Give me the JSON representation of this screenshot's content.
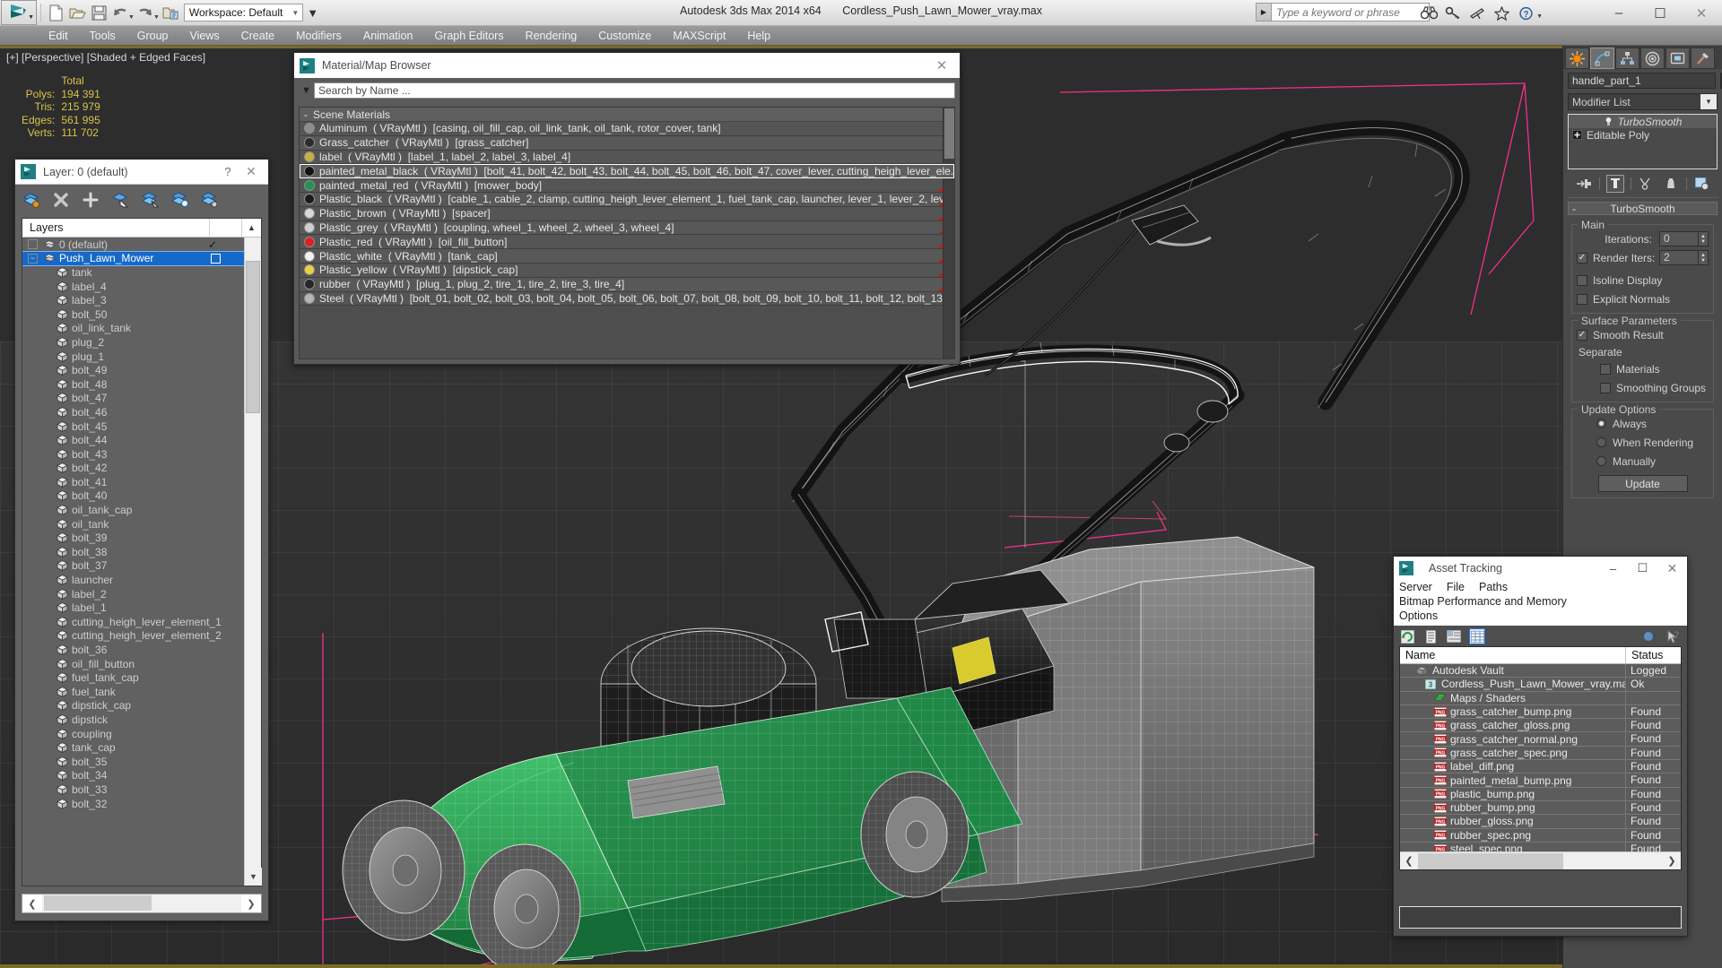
{
  "titlebar": {
    "app_title": "Autodesk 3ds Max  2014 x64",
    "file_title": "Cordless_Push_Lawn_Mower_vray.max",
    "workspace_label": "Workspace: Default",
    "search_placeholder": "Type a keyword or phrase",
    "qat_buttons": [
      "new-icon",
      "open-icon",
      "save-icon",
      "undo-icon",
      "redo-icon",
      "set-project-folder-icon"
    ],
    "right_icons": [
      "binoculars-icon",
      "key-icon",
      "satellite-icon",
      "star-icon",
      "help-icon"
    ],
    "window_buttons": [
      "minimize",
      "maximize",
      "close"
    ]
  },
  "menubar": {
    "items": [
      "Edit",
      "Tools",
      "Group",
      "Views",
      "Create",
      "Modifiers",
      "Animation",
      "Graph Editors",
      "Rendering",
      "Customize",
      "MAXScript",
      "Help"
    ]
  },
  "viewport": {
    "label": "[+] [Perspective] [Shaded + Edged Faces]",
    "stats_header": "Total",
    "stats": [
      {
        "key": "Polys:",
        "value": "194 391"
      },
      {
        "key": "Tris:",
        "value": "215 979"
      },
      {
        "key": "Edges:",
        "value": "561 995"
      },
      {
        "key": "Verts:",
        "value": "111 702"
      }
    ]
  },
  "layer_dialog": {
    "title": "Layer: 0 (default)",
    "help_glyph": "?",
    "close_glyph": "✕",
    "toolbar_icons": [
      "create-new-layer-icon",
      "delete-layer-icon",
      "add-selection-icon",
      "select-objects-icon",
      "select-highlighted-icon",
      "highlight-selected-icon",
      "layer-properties-icon"
    ],
    "column_header": "Layers",
    "rows": [
      {
        "label": "0 (default)",
        "level": 0,
        "type": "layer",
        "selected": false,
        "check": true
      },
      {
        "label": "Push_Lawn_Mower",
        "level": 0,
        "type": "layer",
        "selected": true,
        "check": false
      },
      {
        "label": "tank",
        "level": 1,
        "type": "object"
      },
      {
        "label": "label_4",
        "level": 1,
        "type": "object"
      },
      {
        "label": "label_3",
        "level": 1,
        "type": "object"
      },
      {
        "label": "bolt_50",
        "level": 1,
        "type": "object"
      },
      {
        "label": "oil_link_tank",
        "level": 1,
        "type": "object"
      },
      {
        "label": "plug_2",
        "level": 1,
        "type": "object"
      },
      {
        "label": "plug_1",
        "level": 1,
        "type": "object"
      },
      {
        "label": "bolt_49",
        "level": 1,
        "type": "object"
      },
      {
        "label": "bolt_48",
        "level": 1,
        "type": "object"
      },
      {
        "label": "bolt_47",
        "level": 1,
        "type": "object"
      },
      {
        "label": "bolt_46",
        "level": 1,
        "type": "object"
      },
      {
        "label": "bolt_45",
        "level": 1,
        "type": "object"
      },
      {
        "label": "bolt_44",
        "level": 1,
        "type": "object"
      },
      {
        "label": "bolt_43",
        "level": 1,
        "type": "object"
      },
      {
        "label": "bolt_42",
        "level": 1,
        "type": "object"
      },
      {
        "label": "bolt_41",
        "level": 1,
        "type": "object"
      },
      {
        "label": "bolt_40",
        "level": 1,
        "type": "object"
      },
      {
        "label": "oil_tank_cap",
        "level": 1,
        "type": "object"
      },
      {
        "label": "oil_tank",
        "level": 1,
        "type": "object"
      },
      {
        "label": "bolt_39",
        "level": 1,
        "type": "object"
      },
      {
        "label": "bolt_38",
        "level": 1,
        "type": "object"
      },
      {
        "label": "bolt_37",
        "level": 1,
        "type": "object"
      },
      {
        "label": "launcher",
        "level": 1,
        "type": "object"
      },
      {
        "label": "label_2",
        "level": 1,
        "type": "object"
      },
      {
        "label": "label_1",
        "level": 1,
        "type": "object"
      },
      {
        "label": "cutting_heigh_lever_element_1",
        "level": 1,
        "type": "object"
      },
      {
        "label": "cutting_heigh_lever_element_2",
        "level": 1,
        "type": "object"
      },
      {
        "label": "bolt_36",
        "level": 1,
        "type": "object"
      },
      {
        "label": "oil_fill_button",
        "level": 1,
        "type": "object"
      },
      {
        "label": "fuel_tank_cap",
        "level": 1,
        "type": "object"
      },
      {
        "label": "fuel_tank",
        "level": 1,
        "type": "object"
      },
      {
        "label": "dipstick_cap",
        "level": 1,
        "type": "object"
      },
      {
        "label": "dipstick",
        "level": 1,
        "type": "object"
      },
      {
        "label": "coupling",
        "level": 1,
        "type": "object"
      },
      {
        "label": "tank_cap",
        "level": 1,
        "type": "object"
      },
      {
        "label": "bolt_35",
        "level": 1,
        "type": "object"
      },
      {
        "label": "bolt_34",
        "level": 1,
        "type": "object"
      },
      {
        "label": "bolt_33",
        "level": 1,
        "type": "object"
      },
      {
        "label": "bolt_32",
        "level": 1,
        "type": "object"
      }
    ]
  },
  "material_browser": {
    "title": "Material/Map Browser",
    "close_glyph": "✕",
    "search_value": "Search by Name ...",
    "group_label": "Scene Materials",
    "group_toggle": "-",
    "materials": [
      {
        "name": "Aluminum",
        "type": "( VRayMtl )",
        "objects": "[casing, oil_fill_cap, oil_link_tank, oil_tank, rotor_cover, tank]",
        "swatch": "#8d8d8d",
        "selected": false,
        "flag": false
      },
      {
        "name": "Grass_catcher",
        "type": "( VRayMtl )",
        "objects": "[grass_catcher]",
        "swatch": "#2b2b2b",
        "selected": false,
        "flag": false
      },
      {
        "name": "label",
        "type": "( VRayMtl )",
        "objects": "[label_1, label_2, label_3, label_4]",
        "swatch": "#c8b040",
        "selected": false,
        "flag": false
      },
      {
        "name": "painted_metal_black",
        "type": "( VRayMtl )",
        "objects": "[bolt_41, bolt_42, bolt_43, bolt_44, bolt_45, bolt_46, bolt_47, cover_lever, cutting_heigh_lever_ele...",
        "swatch": "#141414",
        "selected": true,
        "flag": false
      },
      {
        "name": "painted_metal_red",
        "type": "( VRayMtl )",
        "objects": "[mower_body]",
        "swatch": "#1f9450",
        "selected": false,
        "flag": true
      },
      {
        "name": "Plastic_black",
        "type": "( VRayMtl )",
        "objects": "[cable_1, cable_2, clamp, cutting_heigh_lever_element_1, fuel_tank_cap, launcher, lever_1, lever_2, lever_...",
        "swatch": "#1a1a1a",
        "selected": false,
        "flag": true
      },
      {
        "name": "Plastic_brown",
        "type": "( VRayMtl )",
        "objects": "[spacer]",
        "swatch": "#d9d9d4",
        "selected": false,
        "flag": true
      },
      {
        "name": "Plastic_grey",
        "type": "( VRayMtl )",
        "objects": "[coupling, wheel_1, wheel_2, wheel_3, wheel_4]",
        "swatch": "#cfcfcf",
        "selected": false,
        "flag": true
      },
      {
        "name": "Plastic_red",
        "type": "( VRayMtl )",
        "objects": "[oil_fill_button]",
        "swatch": "#e02020",
        "selected": false,
        "flag": true
      },
      {
        "name": "Plastic_white",
        "type": "( VRayMtl )",
        "objects": "[tank_cap]",
        "swatch": "#f2f2f2",
        "selected": false,
        "flag": true
      },
      {
        "name": "Plastic_yellow",
        "type": "( VRayMtl )",
        "objects": "[dipstick_cap]",
        "swatch": "#e8d23c",
        "selected": false,
        "flag": true
      },
      {
        "name": "rubber",
        "type": "( VRayMtl )",
        "objects": "[plug_1, plug_2, tire_1, tire_2, tire_3, tire_4]",
        "swatch": "#262626",
        "selected": false,
        "flag": true
      },
      {
        "name": "Steel",
        "type": "( VRayMtl )",
        "objects": "[bolt_01, bolt_02, bolt_03, bolt_04, bolt_05, bolt_06, bolt_07, bolt_08, bolt_09, bolt_10, bolt_11, bolt_12, bolt_13,...",
        "swatch": "#b5b5b5",
        "selected": false,
        "flag": false
      }
    ]
  },
  "command_panel": {
    "tabs": [
      "create-tab-icon",
      "modify-tab-icon",
      "hierarchy-tab-icon",
      "motion-tab-icon",
      "display-tab-icon",
      "utilities-tab-icon"
    ],
    "active_tab_index": 1,
    "object_name": "handle_part_1",
    "modifier_list_label": "Modifier List",
    "stack": [
      {
        "label": "TurboSmooth",
        "active": true
      },
      {
        "label": "Editable Poly",
        "active": false
      }
    ],
    "rollout": {
      "title": "TurboSmooth",
      "collapse_glyph": "-",
      "groups": [
        {
          "title": "Main",
          "fields": [
            {
              "kind": "spinner",
              "label": "Iterations:",
              "value": "0",
              "checkbox": null
            },
            {
              "kind": "spinner",
              "label": "Render Iters:",
              "value": "2",
              "checkbox": true
            },
            {
              "kind": "checkbox",
              "label": "Isoline Display",
              "checked": false
            },
            {
              "kind": "checkbox",
              "label": "Explicit Normals",
              "checked": false
            }
          ]
        },
        {
          "title": "Surface Parameters",
          "fields": [
            {
              "kind": "checkbox",
              "label": "Smooth Result",
              "checked": true
            },
            {
              "kind": "text",
              "label": "Separate"
            },
            {
              "kind": "checkbox-indent",
              "label": "Materials",
              "checked": false
            },
            {
              "kind": "checkbox-indent",
              "label": "Smoothing Groups",
              "checked": false
            }
          ]
        },
        {
          "title": "Update Options",
          "fields": [
            {
              "kind": "radio",
              "label": "Always",
              "checked": true
            },
            {
              "kind": "radio",
              "label": "When Rendering",
              "checked": false
            },
            {
              "kind": "radio",
              "label": "Manually",
              "checked": false
            },
            {
              "kind": "button",
              "label": "Update"
            }
          ]
        }
      ]
    }
  },
  "asset_tracking": {
    "title": "Asset Tracking",
    "window_buttons": [
      "–",
      "☐",
      "✕"
    ],
    "menu": [
      "Server",
      "File",
      "Paths",
      "Bitmap Performance and Memory",
      "Options"
    ],
    "toolbar_icons": [
      "refresh-icon",
      "list-view-icon",
      "detail-view-icon",
      "grid-view-icon",
      "add-help-icon",
      "help-cursor-icon"
    ],
    "columns": [
      "Name",
      "Status"
    ],
    "rows": [
      {
        "name": "Autodesk Vault",
        "status": "Logged",
        "indent": 1,
        "icon": "vault-icon"
      },
      {
        "name": "Cordless_Push_Lawn_Mower_vray.max",
        "status": "Ok",
        "indent": 2,
        "icon": "max-file-icon"
      },
      {
        "name": "Maps / Shaders",
        "status": "",
        "indent": 3,
        "icon": "maps-icon"
      },
      {
        "name": "grass_catcher_bump.png",
        "status": "Found",
        "indent": 3,
        "icon": "png-icon"
      },
      {
        "name": "grass_catcher_gloss.png",
        "status": "Found",
        "indent": 3,
        "icon": "png-icon"
      },
      {
        "name": "grass_catcher_normal.png",
        "status": "Found",
        "indent": 3,
        "icon": "png-icon"
      },
      {
        "name": "grass_catcher_spec.png",
        "status": "Found",
        "indent": 3,
        "icon": "png-icon"
      },
      {
        "name": "label_diff.png",
        "status": "Found",
        "indent": 3,
        "icon": "png-icon"
      },
      {
        "name": "painted_metal_bump.png",
        "status": "Found",
        "indent": 3,
        "icon": "png-icon"
      },
      {
        "name": "plastic_bump.png",
        "status": "Found",
        "indent": 3,
        "icon": "png-icon"
      },
      {
        "name": "rubber_bump.png",
        "status": "Found",
        "indent": 3,
        "icon": "png-icon"
      },
      {
        "name": "rubber_gloss.png",
        "status": "Found",
        "indent": 3,
        "icon": "png-icon"
      },
      {
        "name": "rubber_spec.png",
        "status": "Found",
        "indent": 3,
        "icon": "png-icon"
      },
      {
        "name": "steel_spec.png",
        "status": "Found",
        "indent": 3,
        "icon": "png-icon"
      }
    ]
  },
  "colors": {
    "viewport_bg": "#2d2d2d",
    "stats_text": "#d8c24a",
    "selection_blue": "#1669c8",
    "mower_green": "#2d9e55",
    "flag_red": "#c81a16",
    "viewport_border": "#7d6c27",
    "gizmo_pink": "#ff2f8e"
  }
}
